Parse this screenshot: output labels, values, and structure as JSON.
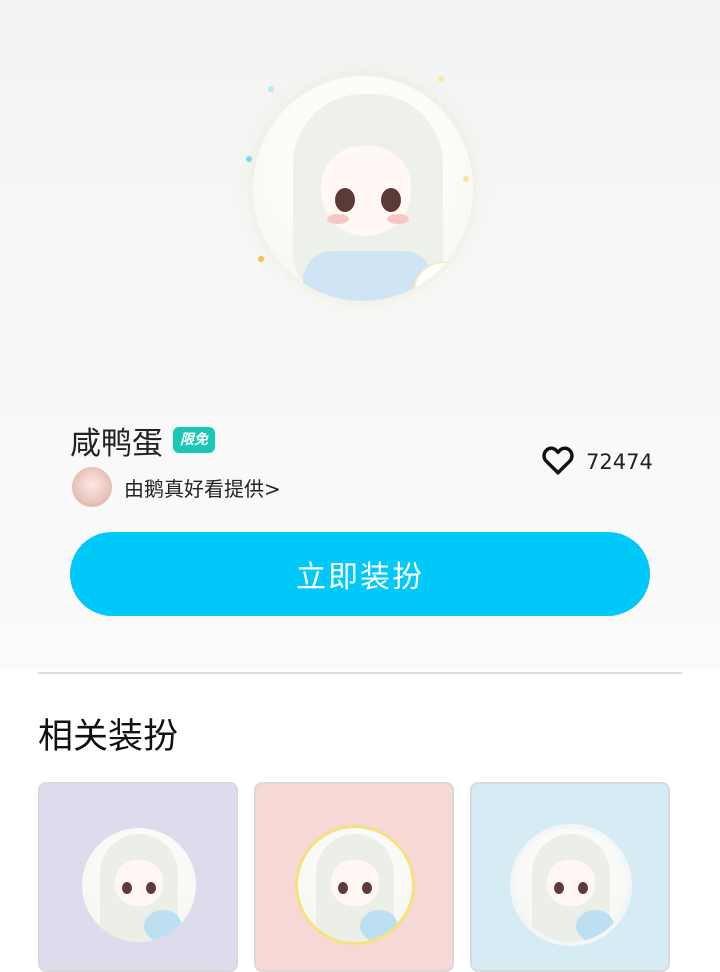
{
  "item": {
    "name": "咸鸭蛋",
    "badge": "限免",
    "provider": "由鹅真好看提供>",
    "likes": "72474"
  },
  "actions": {
    "apply_label": "立即装扮"
  },
  "related": {
    "title": "相关装扮",
    "cards": [
      {
        "bg": "#dcdcec",
        "icon": "avatar-frame-thumbnail"
      },
      {
        "bg": "#f6d8d6",
        "icon": "avatar-frame-thumbnail"
      },
      {
        "bg": "#d6ecf4",
        "icon": "avatar-frame-thumbnail"
      }
    ]
  },
  "colors": {
    "accent": "#00c8f8",
    "badge": "#19c7b7"
  },
  "icons": {
    "like": "heart-outline-icon"
  }
}
